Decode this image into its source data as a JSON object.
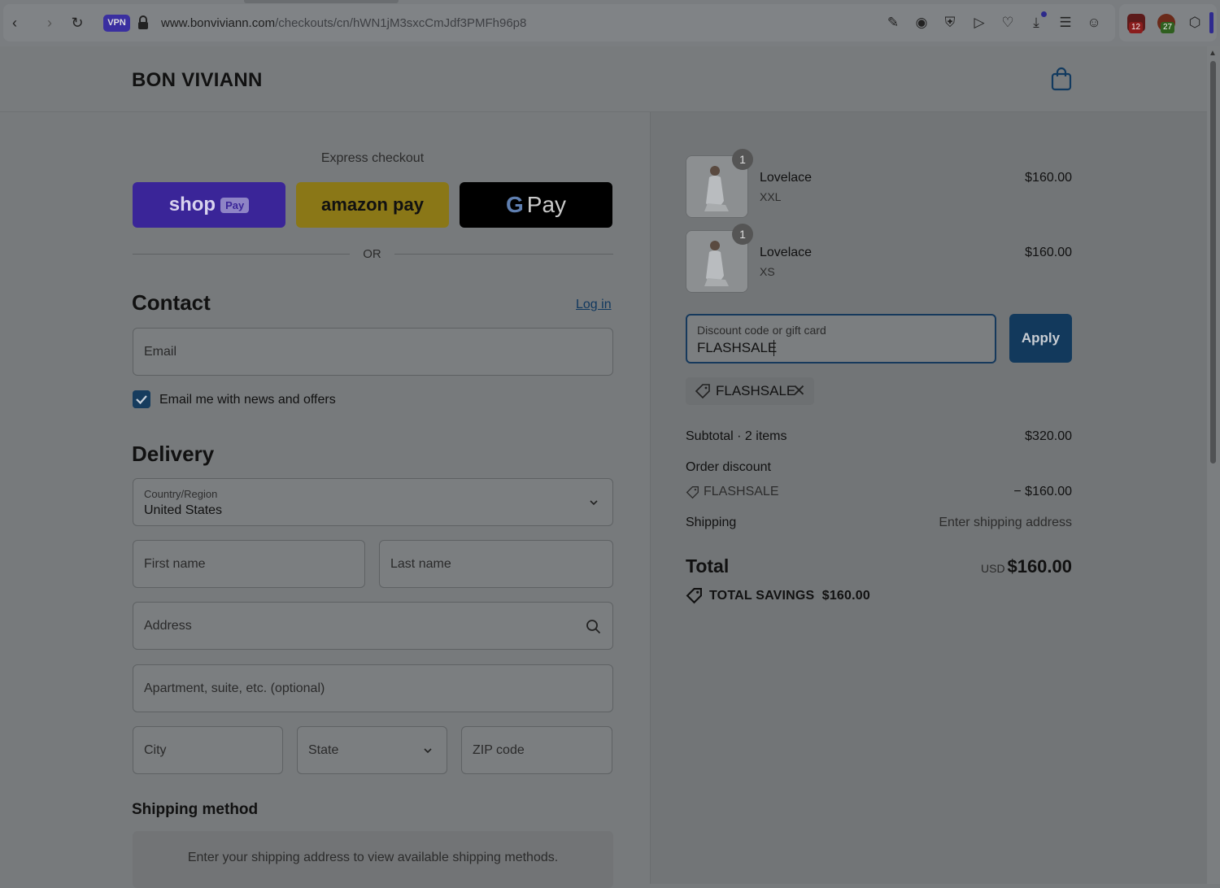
{
  "browser": {
    "vpn_label": "VPN",
    "url_host": "www.bonviviann.com",
    "url_path": "/checkouts/cn/hWN1jM3sxcCmJdf3PMFh96p8",
    "ext_badge_1": "12",
    "ext_badge_2": "27"
  },
  "header": {
    "brand": "BON VIVIANN"
  },
  "express": {
    "title": "Express checkout",
    "shop_label": "shop",
    "shop_pay_tag": "Pay",
    "amazon_label": "amazon pay",
    "gpay_g": "G",
    "gpay_label": "Pay",
    "or_label": "OR"
  },
  "contact": {
    "heading": "Contact",
    "login_label": "Log in",
    "email_placeholder": "Email",
    "newsletter_label": "Email me with news and offers",
    "newsletter_checked": true
  },
  "delivery": {
    "heading": "Delivery",
    "country_label": "Country/Region",
    "country_value": "United States",
    "first_name_placeholder": "First name",
    "last_name_placeholder": "Last name",
    "address_placeholder": "Address",
    "apartment_placeholder": "Apartment, suite, etc. (optional)",
    "city_placeholder": "City",
    "state_placeholder": "State",
    "zip_placeholder": "ZIP code"
  },
  "shipping_method": {
    "heading": "Shipping method",
    "notice": "Enter your shipping address to view available shipping methods."
  },
  "summary": {
    "items": [
      {
        "qty": "1",
        "name": "Lovelace",
        "variant": "XXL",
        "price": "$160.00"
      },
      {
        "qty": "1",
        "name": "Lovelace",
        "variant": "XS",
        "price": "$160.00"
      }
    ],
    "discount_label": "Discount code or gift card",
    "discount_value": "FLASHSALE",
    "apply_label": "Apply",
    "applied_code": "FLASHSALE",
    "subtotal_label": "Subtotal · 2 items",
    "subtotal_value": "$320.00",
    "order_discount_label": "Order discount",
    "order_discount_code": "FLASHSALE",
    "order_discount_value": "− $160.00",
    "shipping_label": "Shipping",
    "shipping_value": "Enter shipping address",
    "total_label": "Total",
    "currency": "USD",
    "total_value": "$160.00",
    "savings_label": "TOTAL SAVINGS",
    "savings_value": "$160.00"
  },
  "colors": {
    "primary": "#12395c",
    "shop_pay": "#3a2598",
    "amazon_pay": "#8a7717",
    "google_pay": "#000000"
  }
}
